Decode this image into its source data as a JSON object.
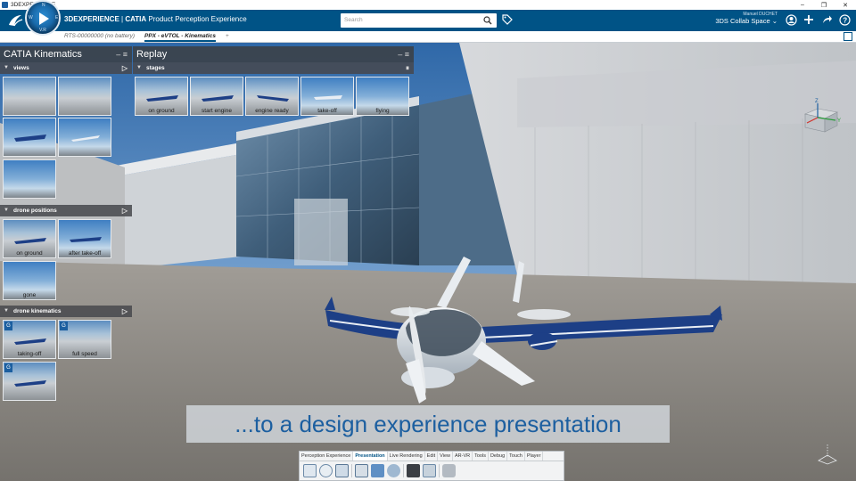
{
  "os": {
    "title": "3DEXPERIENCE",
    "controls": [
      "–",
      "❐",
      "✕"
    ]
  },
  "header": {
    "brand_bold": "3DEXPERIENCE",
    "brand_sep": " | ",
    "brand_app": "CATIA",
    "brand_rest": " Product Perception Experience",
    "search_placeholder": "Search",
    "user_name": "Manuel DUCHET",
    "space_name": "3DS Collab Space ⌄"
  },
  "compass_letters": {
    "n": "N",
    "w": "W",
    "e": "E",
    "s": "S",
    "v": "V.R"
  },
  "tabs": [
    {
      "label": "RTS-00000000 (no battery)"
    },
    {
      "label": "PPX - eVTOL - Kinematics"
    }
  ],
  "tab_add": "+",
  "left_panel": {
    "title": "CATIA Kinematics",
    "sections": [
      {
        "label": "views",
        "thumbs": [
          "",
          "",
          "",
          "",
          ""
        ]
      },
      {
        "label": "drone positions",
        "thumbs": [
          "on ground",
          "after take-off",
          "gone"
        ]
      },
      {
        "label": "drone kinematics",
        "thumbs": [
          "taking-off",
          "full speed",
          ""
        ]
      }
    ]
  },
  "replay_panel": {
    "title": "Replay",
    "section": "stages",
    "thumbs": [
      "on ground",
      "start engine",
      "engine ready",
      "take-off",
      "flying"
    ]
  },
  "subtitle": "...to a design experience presentation",
  "toolbar": {
    "tabs": [
      "Perception Experience",
      "Presentation",
      "Live Rendering",
      "Edit",
      "View",
      "AR-VR",
      "Tools",
      "Debug",
      "Touch",
      "Player"
    ],
    "active_tab": "Presentation"
  },
  "axis": {
    "z": "Z",
    "y": "Y"
  },
  "colors": {
    "header": "#005386",
    "accent": "#1c5fa0",
    "wing": "#1d3f86"
  }
}
